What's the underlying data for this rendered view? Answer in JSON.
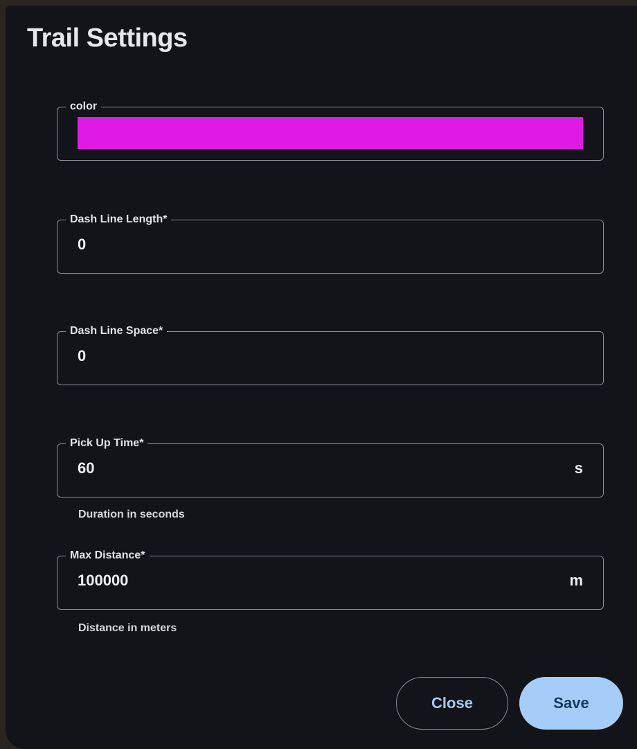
{
  "dialog": {
    "title": "Trail Settings"
  },
  "fields": {
    "color": {
      "label": "color",
      "value": "#e01ae6"
    },
    "dash_line_length": {
      "label": "Dash Line Length*",
      "value": "0"
    },
    "dash_line_space": {
      "label": "Dash Line Space*",
      "value": "0"
    },
    "pick_up_time": {
      "label": "Pick Up Time*",
      "value": "60",
      "unit": "s",
      "helper": "Duration in seconds"
    },
    "max_distance": {
      "label": "Max Distance*",
      "value": "100000",
      "unit": "m",
      "helper": "Distance in meters"
    }
  },
  "actions": {
    "close_label": "Close",
    "save_label": "Save"
  },
  "colors": {
    "dialog_background": "#121419",
    "primary_button": "#a6cdf7",
    "outline": "#8d9099"
  }
}
